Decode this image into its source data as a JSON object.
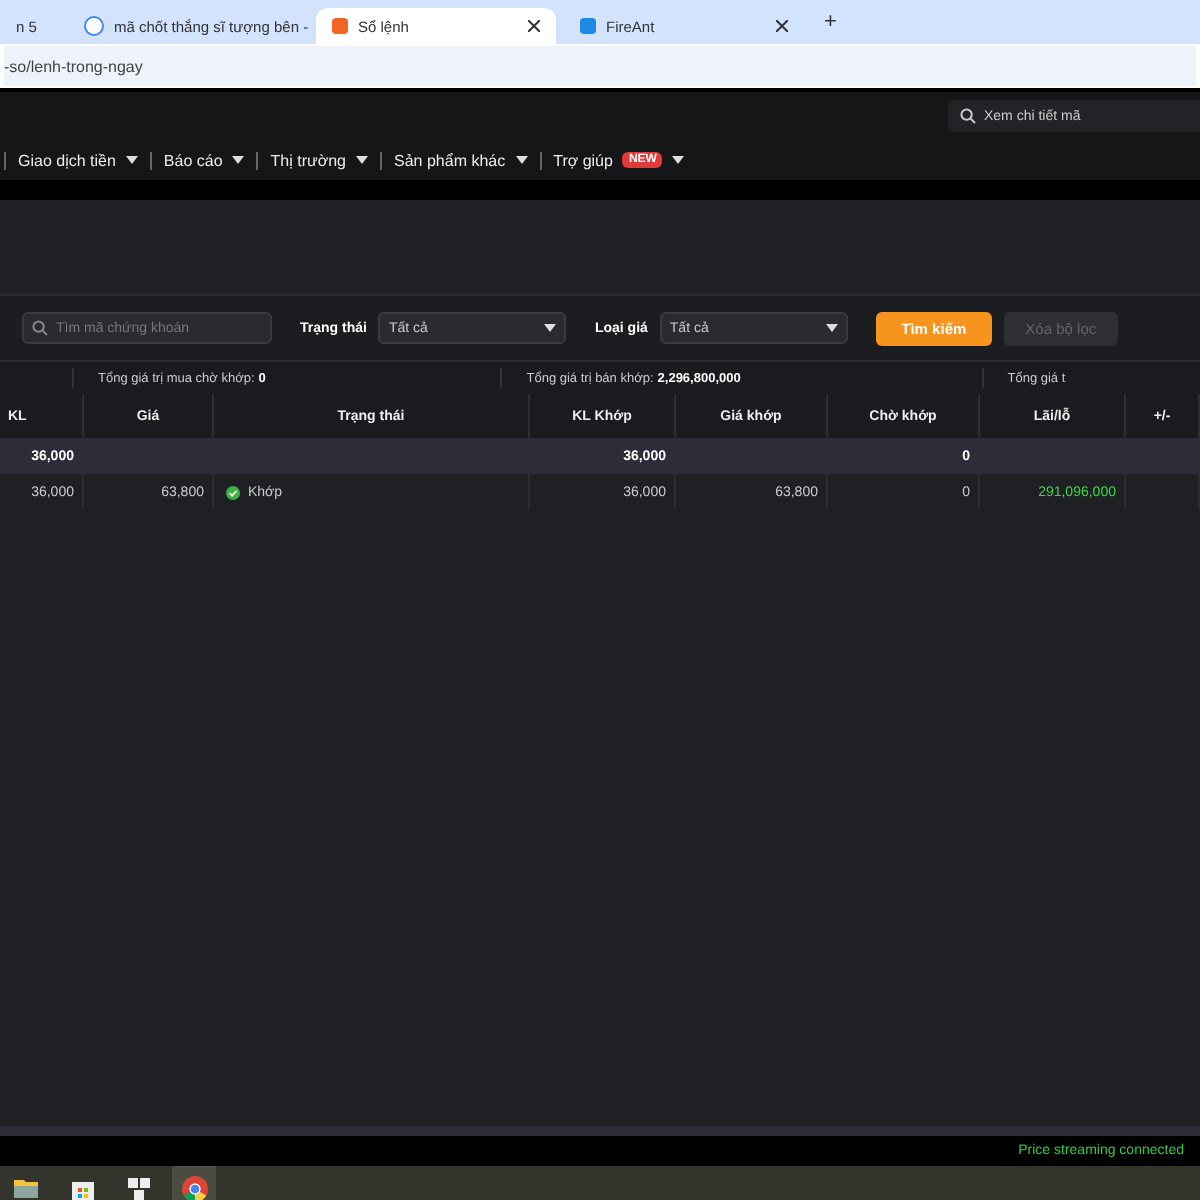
{
  "browser_tabs": [
    {
      "title": "n 5",
      "selected": false
    },
    {
      "title": "mã chốt thắng sĩ tượng bên -",
      "selected": false
    },
    {
      "title": "Sổ lệnh",
      "selected": true
    },
    {
      "title": "FireAnt",
      "selected": false
    }
  ],
  "new_tab": "+",
  "address": "-so/lenh-trong-ngay",
  "header_search": {
    "placeholder": "Xem chi tiết mã"
  },
  "nav": [
    {
      "label": "Giao dịch tiền"
    },
    {
      "label": "Báo cáo"
    },
    {
      "label": "Thị trường"
    },
    {
      "label": "Sản phẩm khác"
    },
    {
      "label": "Trợ giúp",
      "badge": "NEW"
    }
  ],
  "filters": {
    "search_placeholder": "Tìm mã chứng khoán",
    "status_label": "Trạng thái",
    "status_value": "Tất cả",
    "price_label": "Loại giá",
    "price_value": "Tất cả",
    "search_button": "Tìm kiếm",
    "clear_button": "Xóa bộ lọc",
    "clear_disabled": true
  },
  "summary": [
    {
      "label": "Tổng giá trị mua chờ khớp:",
      "value": "0"
    },
    {
      "label": "Tổng giá trị bán khớp:",
      "value": "2,296,800,000"
    },
    {
      "label": "Tổng giá t"
    }
  ],
  "table": {
    "columns": [
      "KL",
      "Giá",
      "Trạng thái",
      "KL Khớp",
      "Giá khớp",
      "Chờ khớp",
      "Lãi/lỗ",
      "+/-"
    ],
    "total_row": {
      "kl": "36,000",
      "kl_khop": "36,000",
      "cho_khop": "0"
    },
    "rows": [
      {
        "cells": [
          "36,000",
          "63,800",
          "Khớp",
          "36,000",
          "63,800",
          "0",
          "291,096,000",
          ""
        ],
        "matched": true
      }
    ]
  },
  "status_bar": "Price streaming connected"
}
